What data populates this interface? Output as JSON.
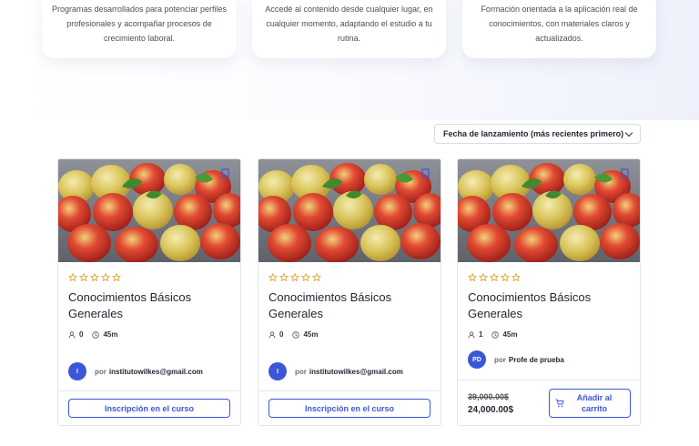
{
  "features": [
    {
      "text": "Programas desarrollados para potenciar perfiles profesionales y acompañar procesos de crecimiento laboral."
    },
    {
      "text": "Accedé al contenido desde cualquier lugar, en cualquier momento, adaptando el estudio a tu rutina."
    },
    {
      "text": "Formación orientada a la aplicación real de conocimientos, con materiales claros y actualizados."
    }
  ],
  "sort": {
    "selected": "Fecha de lanzamiento (más recientes primero)"
  },
  "courses": [
    {
      "title": "Conocimientos Básicos Generales",
      "students": "0",
      "duration": "45m",
      "avatar": "I",
      "by": "por",
      "author": "institutowilkes@gmail.com",
      "action": "Inscripción en el curso"
    },
    {
      "title": "Conocimientos Básicos Generales",
      "students": "0",
      "duration": "45m",
      "avatar": "I",
      "by": "por",
      "author": "institutowilkes@gmail.com",
      "action": "Inscripción en el curso"
    },
    {
      "title": "Conocimientos Básicos Generales",
      "students": "1",
      "duration": "45m",
      "avatar": "PD",
      "by": "por",
      "author": "Profe de prueba",
      "old_price": "39,000.00$",
      "price": "24,000.00$",
      "action": "Añadir al carrito"
    }
  ],
  "colors": {
    "accent": "#3b57d6",
    "star": "#d99a1e"
  }
}
